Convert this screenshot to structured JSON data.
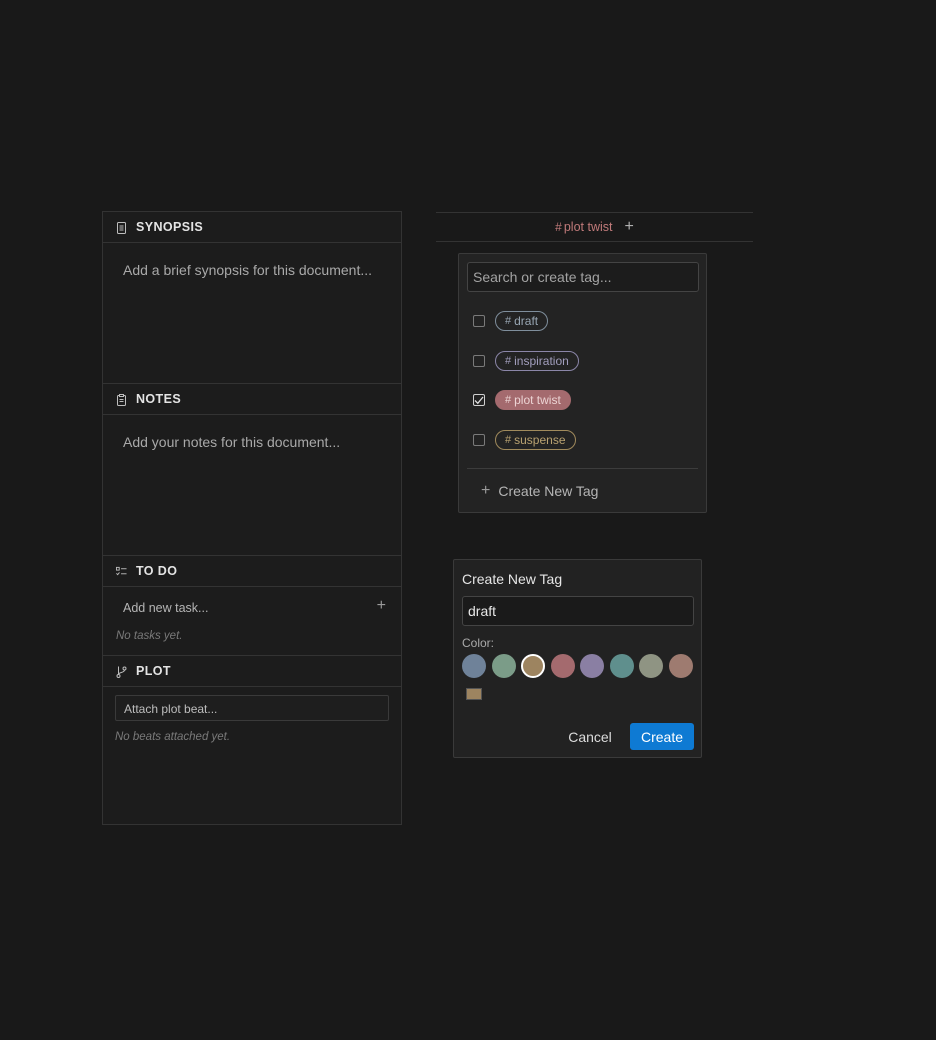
{
  "inspector": {
    "synopsis": {
      "title": "SYNOPSIS",
      "placeholder": "Add a brief synopsis for this document..."
    },
    "notes": {
      "title": "NOTES",
      "placeholder": "Add your notes for this document..."
    },
    "todo": {
      "title": "TO DO",
      "add_label": "Add new task...",
      "add_button": "+",
      "empty": "No tasks yet."
    },
    "plot": {
      "title": "PLOT",
      "attach_label": "Attach plot beat...",
      "empty": "No beats attached yet."
    }
  },
  "tagbar": {
    "hash": "#",
    "active_tag": "plot twist",
    "add_button": "+"
  },
  "dropdown": {
    "search_placeholder": "Search or create tag...",
    "hash": "#",
    "tags": [
      {
        "label": "draft",
        "checked": false,
        "color": "#7f8e9c"
      },
      {
        "label": "inspiration",
        "checked": false,
        "color": "#8b86a8"
      },
      {
        "label": "plot twist",
        "checked": true,
        "color": "#a46a6e"
      },
      {
        "label": "suspense",
        "checked": false,
        "color": "#a08a5c"
      }
    ],
    "create_plus": "+",
    "create_label": "Create New Tag"
  },
  "dialog": {
    "title": "Create New Tag",
    "name_value": "draft",
    "color_label": "Color:",
    "swatches": [
      "#6f8299",
      "#7b9c88",
      "#9d8460",
      "#a46a6e",
      "#8a7fa3",
      "#5f8f8d",
      "#8f9483",
      "#9e7b70"
    ],
    "selected_swatch": "#9d8460",
    "custom_color": "#9d8460",
    "cancel_label": "Cancel",
    "create_label": "Create"
  }
}
